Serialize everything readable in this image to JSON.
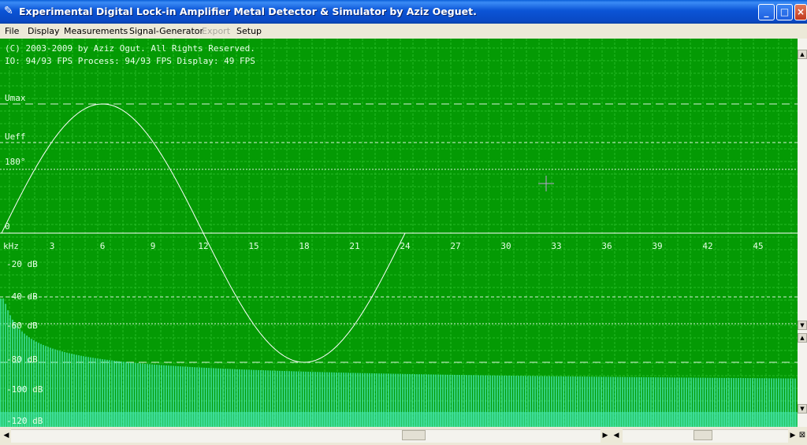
{
  "window": {
    "title": "Experimental Digital Lock-in Amplifier Metal Detector & Simulator by Aziz Oeguet.",
    "app_icon": "pen-icon",
    "buttons": {
      "minimize": "_",
      "maximize": "□",
      "close": "×"
    }
  },
  "menu": [
    {
      "label": "File",
      "enabled": true
    },
    {
      "label": "Display",
      "enabled": true
    },
    {
      "label": "Measurements",
      "enabled": true
    },
    {
      "label": "Signal-Generator",
      "enabled": true
    },
    {
      "label": "Export",
      "enabled": false
    },
    {
      "label": "Setup",
      "enabled": true
    }
  ],
  "scope": {
    "colors": {
      "background": "#049a04",
      "grid": "#2fc42f",
      "trace": "#ffffff",
      "spectrum": "#45e8b0",
      "text": "#e8ffe8"
    },
    "copyright": "(C) 2003-2009 by Aziz Ogut. All Rights Reserved.",
    "stats": "IO: 94/93 FPS  Process: 94/93 FPS  Display: 49 FPS",
    "upper_labels": {
      "umax": "Umax",
      "ueff": "Ueff",
      "phase": "180°",
      "zero": "0"
    },
    "freq_axis": {
      "unit": "kHz",
      "ticks": [
        "3",
        "6",
        "9",
        "12",
        "15",
        "18",
        "21",
        "24",
        "27",
        "30",
        "33",
        "36",
        "39",
        "42",
        "45"
      ]
    },
    "db_labels": [
      "-20 dB",
      "-40 dB",
      "-60 dB",
      "-80 dB",
      "-100 dB",
      "-120 dB"
    ],
    "cursor": "crosshair-cursor"
  },
  "chart_data": {
    "type": "line",
    "series": [
      {
        "description": "sine wave: one period over the 0–24 kHz span; peak at 6, trough at 18",
        "x": [
          0,
          3,
          6,
          9,
          12,
          15,
          18,
          21,
          24
        ],
        "y": [
          0,
          0.71,
          1,
          0.71,
          0,
          -0.71,
          -1,
          -0.71,
          0
        ]
      }
    ],
    "spectrum": {
      "type": "bar",
      "description": "decaying spectrum bars from 0 to ~47 kHz"
    }
  }
}
